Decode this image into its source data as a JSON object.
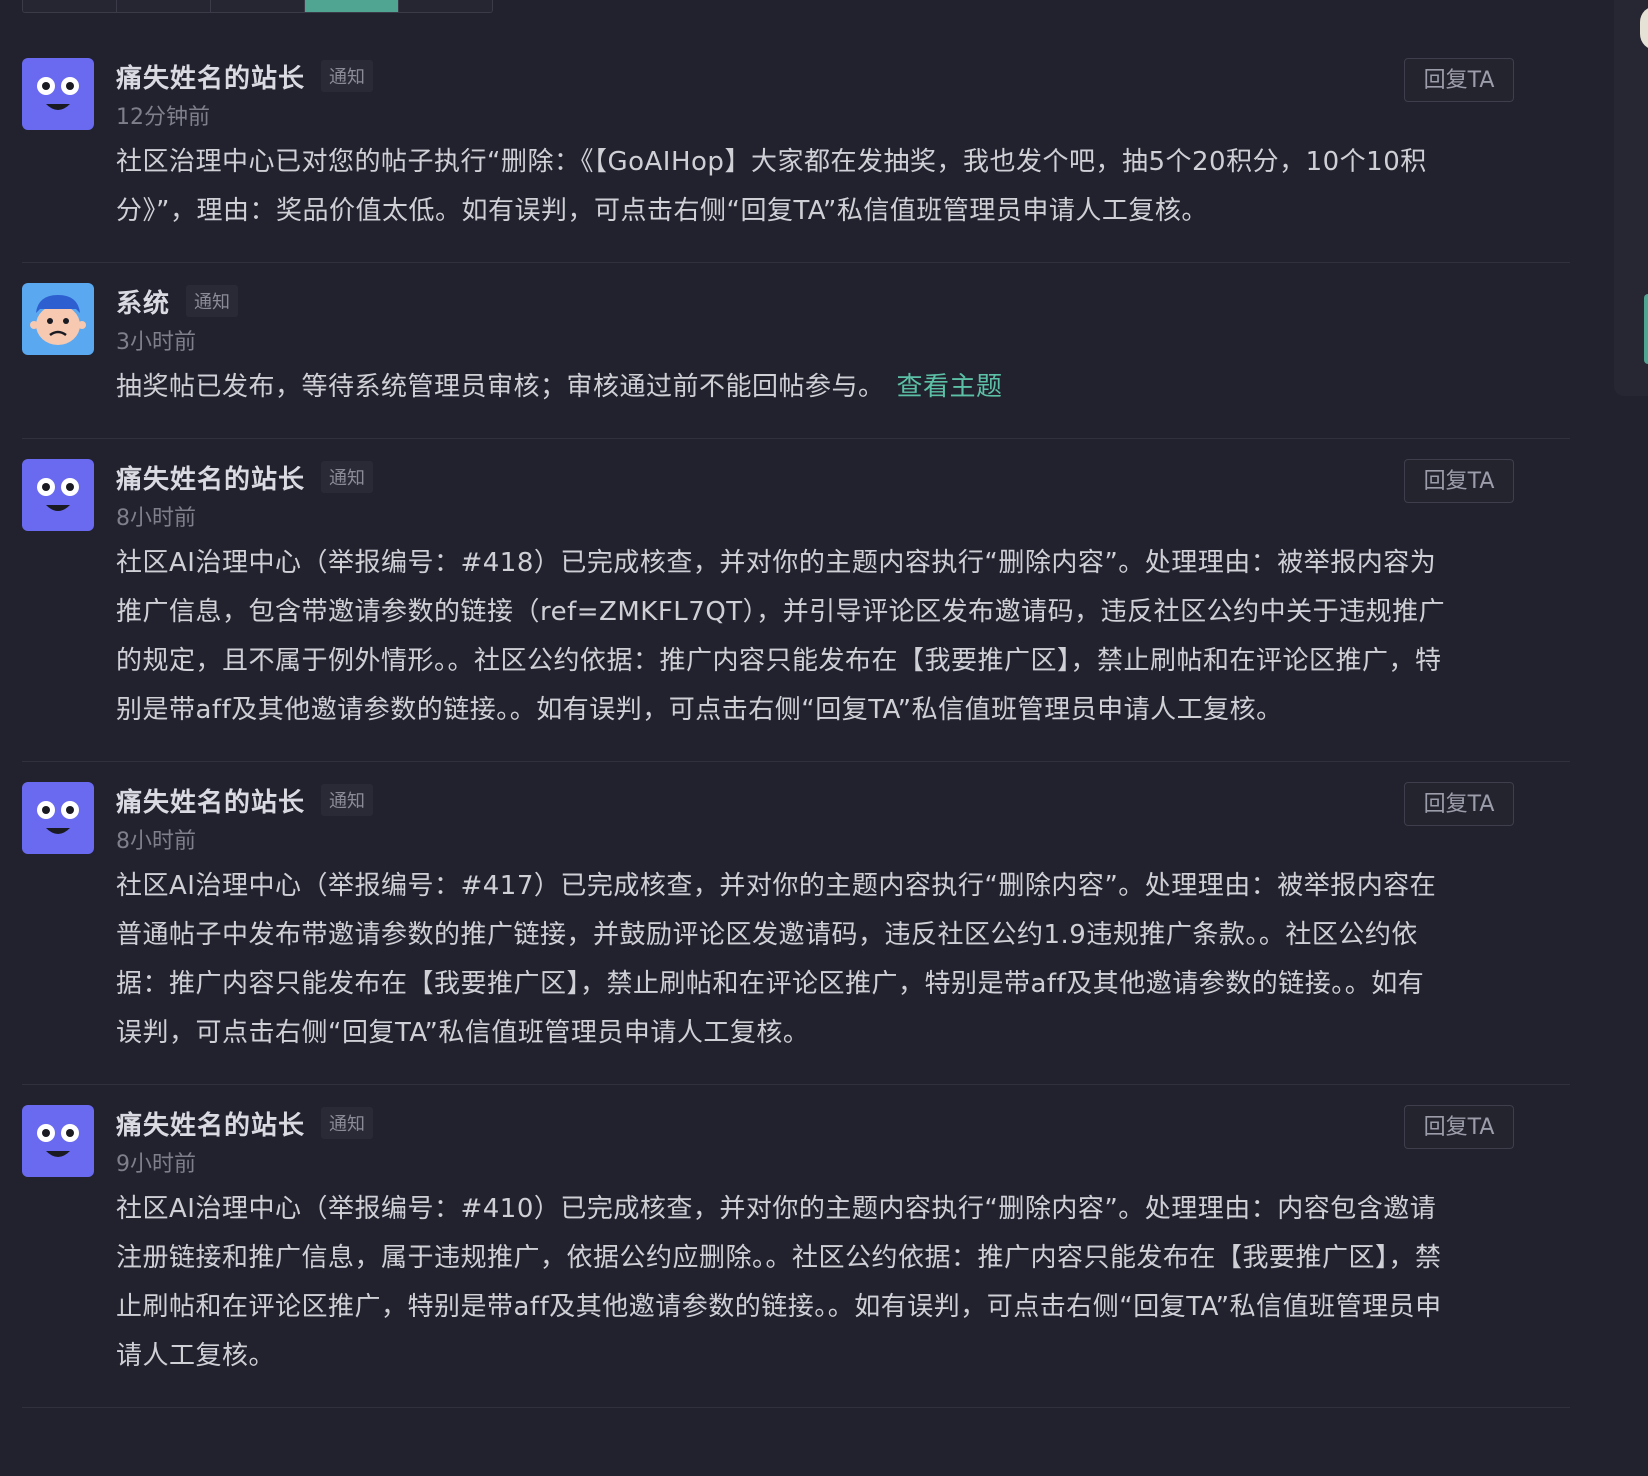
{
  "tabs": [
    {
      "label": "",
      "active": false
    },
    {
      "label": "",
      "active": false
    },
    {
      "label": "",
      "active": false
    },
    {
      "label": "",
      "active": true
    },
    {
      "label": "",
      "active": false
    }
  ],
  "colors": {
    "background": "#22222e",
    "accent": "#4fa591",
    "link": "#5cc0a6",
    "avatar_purple": "#6a6af0",
    "avatar_blue": "#5aa8f0"
  },
  "notifications": [
    {
      "avatar": "smiley-face-icon",
      "name": "痛失姓名的站长",
      "tag": "通知",
      "time": "12分钟前",
      "body": "社区治理中心已对您的帖子执行“删除：《【GoAIHop】大家都在发抽奖，我也发个吧，抽5个20积分，10个10积分》”，理由：奖品价值太低。如有误判，可点击右侧“回复TA”私信值班管理员申请人工复核。",
      "reply_label": "回复TA"
    },
    {
      "avatar": "system-face-icon",
      "name": "系统",
      "tag": "通知",
      "time": "3小时前",
      "body": "抽奖帖已发布，等待系统管理员审核；审核通过前不能回帖参与。",
      "link_label": "查看主题"
    },
    {
      "avatar": "smiley-face-icon",
      "name": "痛失姓名的站长",
      "tag": "通知",
      "time": "8小时前",
      "body": "社区AI治理中心（举报编号：#418）已完成核查，并对你的主题内容执行“删除内容”。处理理由：被举报内容为推广信息，包含带邀请参数的链接（ref=ZMKFL7QT），并引导评论区发布邀请码，违反社区公约中关于违规推广的规定，且不属于例外情形。。社区公约依据：推广内容只能发布在【我要推广区】，禁止刷帖和在评论区推广，特别是带aff及其他邀请参数的链接。。如有误判，可点击右侧“回复TA”私信值班管理员申请人工复核。",
      "reply_label": "回复TA"
    },
    {
      "avatar": "smiley-face-icon",
      "name": "痛失姓名的站长",
      "tag": "通知",
      "time": "8小时前",
      "body": "社区AI治理中心（举报编号：#417）已完成核查，并对你的主题内容执行“删除内容”。处理理由：被举报内容在普通帖子中发布带邀请参数的推广链接，并鼓励评论区发邀请码，违反社区公约1.9违规推广条款。。社区公约依据：推广内容只能发布在【我要推广区】，禁止刷帖和在评论区推广，特别是带aff及其他邀请参数的链接。。如有误判，可点击右侧“回复TA”私信值班管理员申请人工复核。",
      "reply_label": "回复TA"
    },
    {
      "avatar": "smiley-face-icon",
      "name": "痛失姓名的站长",
      "tag": "通知",
      "time": "9小时前",
      "body": "社区AI治理中心（举报编号：#410）已完成核查，并对你的主题内容执行“删除内容”。处理理由：内容包含邀请注册链接和推广信息，属于违规推广，依据公约应删除。。社区公约依据：推广内容只能发布在【我要推广区】，禁止刷帖和在评论区推广，特别是带aff及其他邀请参数的链接。。如有误判，可点击右侧“回复TA”私信值班管理员申请人工复核。",
      "reply_label": "回复TA"
    }
  ]
}
